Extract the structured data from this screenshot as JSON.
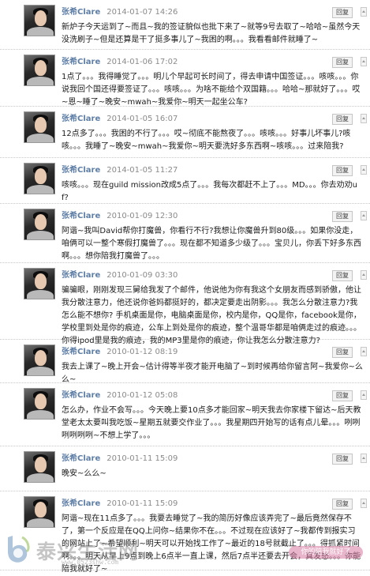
{
  "posts": [
    {
      "author": "张希Clare",
      "date": "2014-01-07 14:26",
      "reply": "回复",
      "text": "新炉子今天运到了~而且~我的签证貌似也批下来了~就等9号去取了~哈哈~虽然今天没洗刷子~但是还算是干了挺多事儿了~我困的啊。。。我看看邮件就睡了~"
    },
    {
      "author": "张希Clare",
      "date": "2014-01-06 17:02",
      "reply": "回复",
      "text": "1点了。。。我得睡觉了。。。明儿个早起可长时间了，得去申请中国签证。。。咳咳。。。你说我回个国还得要签证了。。。咳咳。。。为啥不能给个双国籍。。。哈哈~那就好了。。。哎~恩~睡了~晚安~mwah~我爱你~明天一起坐公车?"
    },
    {
      "author": "张希Clare",
      "date": "2014-01-05 16:07",
      "reply": "回复",
      "text": "12点多了。。。我困的不行了。。。哎~彻底不能熬夜了。。。咳咳。。。好事儿坏事儿?咳咳。。。我睡了~晚安~mwah~我爱你~明天要洗好多东西啊~咳咳。。。过来陪我?"
    },
    {
      "author": "张希Clare",
      "date": "2014-01-05 11:27",
      "reply": "回复",
      "text": "咳咳。。。现在guild mission改成5点了。。。我每次都赶不上了。。。MD。。。你去劝劝uf?"
    },
    {
      "author": "张希Clare",
      "date": "2010-01-09 12:30",
      "reply": "回复",
      "text": "阿谐~我叫David帮你打魔兽，你看行不行?我想让你魔兽升到80级。。。如果你没走，咱俩可以一整个寒假打魔兽了。。。现在都不知道多少级了。。。宝贝儿，你丢下好多东西啊。。。想你陪我打魔兽了。。。"
    },
    {
      "author": "张希Clare",
      "date": "2010-01-09 03:30",
      "reply": "回复",
      "text": "骗骗眼，刚刚发现三舅给我发了个邮件，他说他为你有我这个女朋友而感到骄傲，他让我分散注意力，他还说你爸妈都挺好的，都决定要走出阴影。。。我怎么分散注意力?我怎么能不想你? 手机桌面是你，电脑桌面是你，校内是你，QQ是你，facebook是你，学校里到处是你的痕迹，公车上到处是你的痕迹，整个温哥华都是咱俩走过的痕迹。。。你得ipod里是我的痕迹，我的MP3里是你的痕迹，你让我怎么分散注意力?"
    },
    {
      "author": "张希Clare",
      "date": "2010-01-12 08:19",
      "reply": "回复",
      "text": "我去上课了~晚上开会~估计得等半夜才能开电脑了~到时候再给你留言阿~我爱你~么么~"
    },
    {
      "author": "张希Clare",
      "date": "2010-01-12 05:08",
      "reply": "回复",
      "text": "怎么办，作业不会写。。。今天晚上要10点多才能回家~明天我去你家楼下留达~后天教堂老太太要叫我吃饭~星期五就要交作业了。。。我星期四开始写的话有点儿晕。。。咧咧咧咧咧咧~不想上学了。。。"
    },
    {
      "author": "张希Clare",
      "date": "2010-01-11 15:09",
      "reply": "回复",
      "text": "晚安~么么~"
    },
    {
      "author": "张希Clare",
      "date": "2010-01-11 15:09",
      "reply": "回复",
      "text": "阿谐~现在11点多了。。。我要去睡觉了~我的简历好像应该弄完了~最后竟然保存不了，第一个反应是在QQ上问你~结果你不在。。。不过现在应该好了~我都传到报实习的网站上了~希望顺利~明天可以开始找工作了~最近的18号就截止了。。。得抓紧时间啊。。。明天从早上9点到晚上6点半一直上课，然后7点半还要去开会，真发愁。。。你能陪我就好了~"
    }
  ],
  "watermark": {
    "logo_letter": "b",
    "title": "泰兴生活网",
    "url": "www.0523shw.com",
    "tagline": "你的陪我就好了"
  }
}
